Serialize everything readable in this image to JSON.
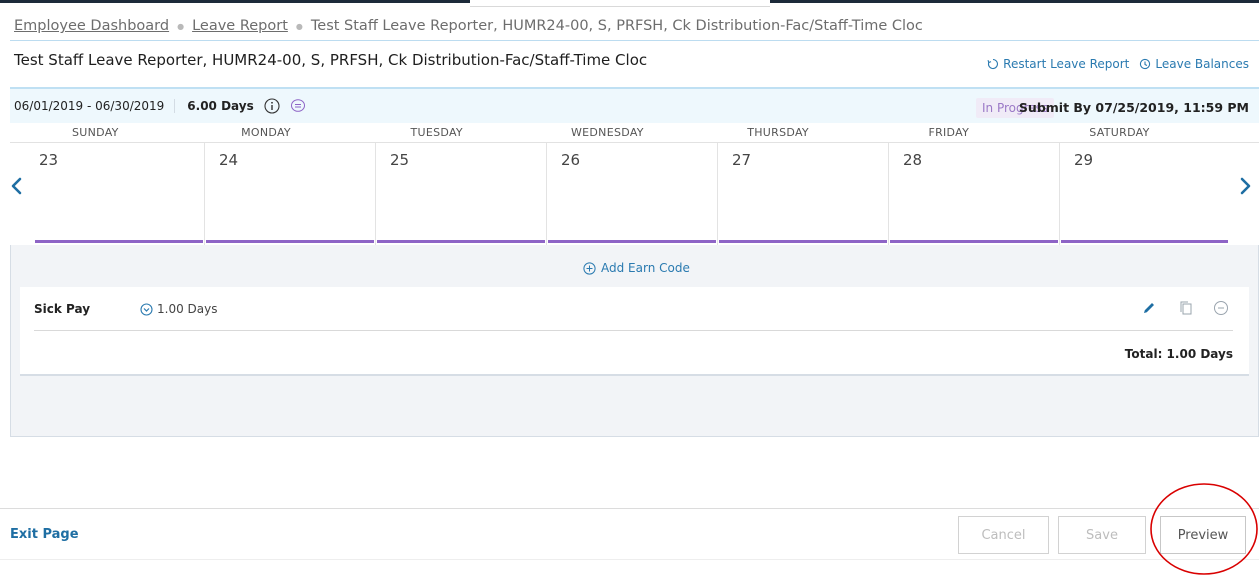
{
  "breadcrumb": {
    "items": [
      "Employee Dashboard",
      "Leave Report",
      "Test Staff Leave Reporter, HUMR24-00, S, PRFSH, Ck Distribution-Fac/Staff-Time Cloc"
    ]
  },
  "page": {
    "title": "Test Staff Leave Reporter, HUMR24-00, S, PRFSH, Ck Distribution-Fac/Staff-Time Cloc",
    "restart_label": "Restart Leave Report",
    "balances_label": "Leave Balances"
  },
  "period": {
    "range": "06/01/2019 - 06/30/2019",
    "days": "6.00 Days",
    "status": "In Progress",
    "submit_by": "Submit By 07/25/2019, 11:59 PM"
  },
  "calendar": {
    "weekdays": [
      "SUNDAY",
      "MONDAY",
      "TUESDAY",
      "WEDNESDAY",
      "THURSDAY",
      "FRIDAY",
      "SATURDAY"
    ],
    "dates": [
      "23",
      "24",
      "25",
      "26",
      "27",
      "28",
      "29"
    ]
  },
  "earn": {
    "add_label": "Add Earn Code",
    "code": "Sick Pay",
    "amount": "1.00 Days",
    "total": "Total: 1.00 Days"
  },
  "footer": {
    "exit_label": "Exit Page",
    "cancel_label": "Cancel",
    "save_label": "Save",
    "preview_label": "Preview"
  },
  "colors": {
    "accent": "#2a7ab0",
    "status_purple": "#8e64c6",
    "annotation_red": "#d90000"
  }
}
